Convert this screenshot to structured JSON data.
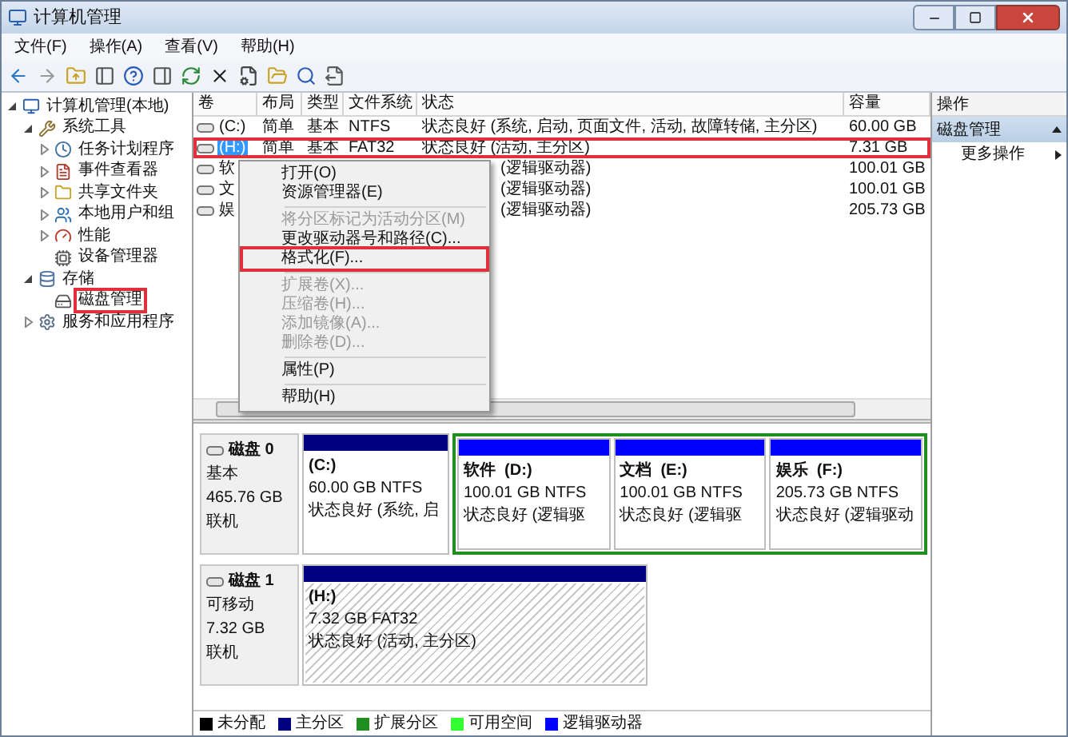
{
  "window": {
    "title": "计算机管理"
  },
  "menu": [
    "文件(F)",
    "操作(A)",
    "查看(V)",
    "帮助(H)"
  ],
  "tree": [
    {
      "label": "计算机管理(本地)",
      "kind": "computer",
      "expanded": true,
      "highlighted": false,
      "children": [
        {
          "label": "系统工具",
          "kind": "tools",
          "expanded": true,
          "highlighted": false,
          "children": [
            {
              "label": "任务计划程序",
              "kind": "clock",
              "expanded": false,
              "highlighted": false
            },
            {
              "label": "事件查看器",
              "kind": "event",
              "expanded": false,
              "highlighted": false
            },
            {
              "label": "共享文件夹",
              "kind": "share",
              "expanded": false,
              "highlighted": false
            },
            {
              "label": "本地用户和组",
              "kind": "users",
              "expanded": false,
              "highlighted": false
            },
            {
              "label": "性能",
              "kind": "perf",
              "expanded": false,
              "highlighted": false
            },
            {
              "label": "设备管理器",
              "kind": "device",
              "highlighted": false
            }
          ]
        },
        {
          "label": "存储",
          "kind": "storage",
          "expanded": true,
          "highlighted": false,
          "children": [
            {
              "label": "磁盘管理",
              "kind": "disk",
              "highlighted": true
            }
          ]
        },
        {
          "label": "服务和应用程序",
          "kind": "services",
          "expanded": false,
          "highlighted": false
        }
      ]
    }
  ],
  "table": {
    "columns": [
      "卷",
      "布局",
      "类型",
      "文件系统",
      "状态",
      "容量"
    ],
    "rows": [
      {
        "volume": "(C:)",
        "layout": "简单",
        "type": "基本",
        "fs": "NTFS",
        "status": "状态良好 (系统, 启动, 页面文件, 活动, 故障转储, 主分区)",
        "capacity": "60.00 GB",
        "selected": false,
        "highlighted": false,
        "covered": false
      },
      {
        "volume": "(H:)",
        "layout": "简单",
        "type": "基本",
        "fs": "FAT32",
        "status": "状态良好 (活动, 主分区)",
        "capacity": "7.31 GB",
        "selected": true,
        "highlighted": true,
        "covered": false
      },
      {
        "volume": "软",
        "status": "(逻辑驱动器)",
        "capacity": "100.01 GB",
        "selected": false,
        "highlighted": false,
        "covered": true
      },
      {
        "volume": "文",
        "status": "(逻辑驱动器)",
        "capacity": "100.01 GB",
        "selected": false,
        "highlighted": false,
        "covered": true
      },
      {
        "volume": "娱",
        "status": "(逻辑驱动器)",
        "capacity": "205.73 GB",
        "selected": false,
        "highlighted": false,
        "covered": true
      }
    ]
  },
  "context_menu": [
    {
      "kind": "item",
      "label": "打开(O)",
      "disabled": false,
      "highlighted": false
    },
    {
      "kind": "item",
      "label": "资源管理器(E)",
      "disabled": false,
      "highlighted": false
    },
    {
      "kind": "separator"
    },
    {
      "kind": "item",
      "label": "将分区标记为活动分区(M)",
      "disabled": true,
      "highlighted": false
    },
    {
      "kind": "item",
      "label": "更改驱动器号和路径(C)...",
      "disabled": false,
      "highlighted": false
    },
    {
      "kind": "item",
      "label": "格式化(F)...",
      "disabled": false,
      "highlighted": true
    },
    {
      "kind": "separator"
    },
    {
      "kind": "item",
      "label": "扩展卷(X)...",
      "disabled": true,
      "highlighted": false
    },
    {
      "kind": "item",
      "label": "压缩卷(H)...",
      "disabled": true,
      "highlighted": false
    },
    {
      "kind": "item",
      "label": "添加镜像(A)...",
      "disabled": true,
      "highlighted": false
    },
    {
      "kind": "item",
      "label": "删除卷(D)...",
      "disabled": true,
      "highlighted": false
    },
    {
      "kind": "separator"
    },
    {
      "kind": "item",
      "label": "属性(P)",
      "disabled": false,
      "highlighted": false
    },
    {
      "kind": "separator"
    },
    {
      "kind": "item",
      "label": "帮助(H)",
      "disabled": false,
      "highlighted": false
    }
  ],
  "disks": [
    {
      "name": "磁盘 0",
      "type": "基本",
      "size": "465.76 GB",
      "status": "联机",
      "partitions": [
        {
          "kind": "primary",
          "label": "(C:)",
          "size": "60.00 GB NTFS",
          "status": "状态良好 (系统, 启",
          "selected": false
        },
        {
          "kind": "extended",
          "children": [
            {
              "kind": "logical",
              "label": "软件  (D:)",
              "size": "100.01 GB NTFS",
              "status": "状态良好 (逻辑驱",
              "selected": false
            },
            {
              "kind": "logical",
              "label": "文档  (E:)",
              "size": "100.01 GB NTFS",
              "status": "状态良好 (逻辑驱",
              "selected": false
            },
            {
              "kind": "logical",
              "label": "娱乐  (F:)",
              "size": "205.73 GB NTFS",
              "status": "状态良好 (逻辑驱动",
              "selected": false
            }
          ]
        }
      ]
    },
    {
      "name": "磁盘 1",
      "type": "可移动",
      "size": "7.32 GB",
      "status": "联机",
      "partitions": [
        {
          "kind": "primary",
          "label": "(H:)",
          "size": "7.32 GB FAT32",
          "status": "状态良好 (活动, 主分区)",
          "selected": true
        }
      ]
    }
  ],
  "legend": [
    {
      "label": "未分配",
      "color": "#000000"
    },
    {
      "label": "主分区",
      "color": "#000080"
    },
    {
      "label": "扩展分区",
      "color": "#1f8f1f"
    },
    {
      "label": "可用空间",
      "color": "#33ff33"
    },
    {
      "label": "逻辑驱动器",
      "color": "#0000ff"
    }
  ],
  "actions": {
    "title": "操作",
    "section": "磁盘管理",
    "items": [
      "更多操作"
    ]
  }
}
